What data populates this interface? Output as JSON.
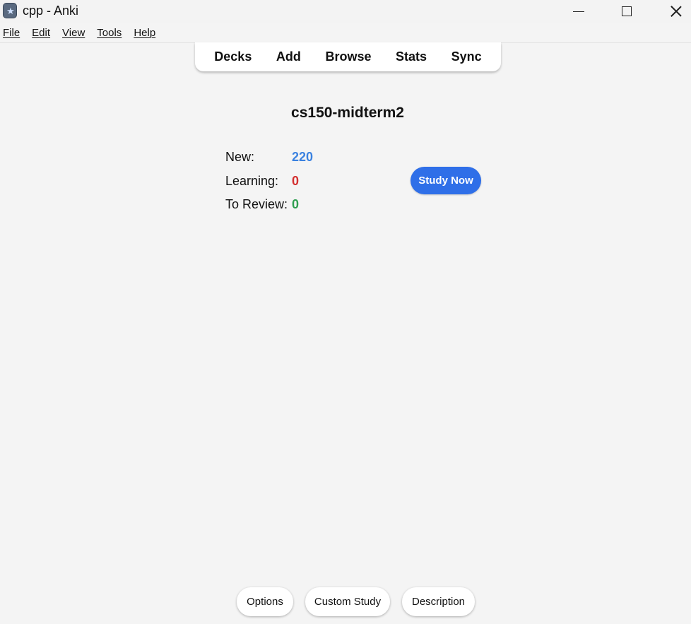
{
  "window": {
    "title": "cpp - Anki",
    "app_icon": "anki-icon",
    "controls": {
      "minimize": "minimize-icon",
      "maximize": "maximize-icon",
      "close": "close-icon"
    }
  },
  "menubar": {
    "items": [
      {
        "label": "File"
      },
      {
        "label": "Edit"
      },
      {
        "label": "View"
      },
      {
        "label": "Tools"
      },
      {
        "label": "Help"
      }
    ]
  },
  "toolbar": {
    "items": [
      {
        "label": "Decks"
      },
      {
        "label": "Add"
      },
      {
        "label": "Browse"
      },
      {
        "label": "Stats"
      },
      {
        "label": "Sync"
      }
    ]
  },
  "overview": {
    "deck_name": "cs150-midterm2",
    "stats": {
      "new_label": "New:",
      "new_value": "220",
      "learning_label": "Learning:",
      "learning_value": "0",
      "review_label": "To Review:",
      "review_value": "0"
    },
    "study_button": "Study Now"
  },
  "bottom_bar": {
    "options": "Options",
    "custom_study": "Custom Study",
    "description": "Description"
  },
  "colors": {
    "new": "#3b82e0",
    "learning": "#d32f2f",
    "review": "#2e9e4f",
    "study_button": "#2f6fe8"
  }
}
